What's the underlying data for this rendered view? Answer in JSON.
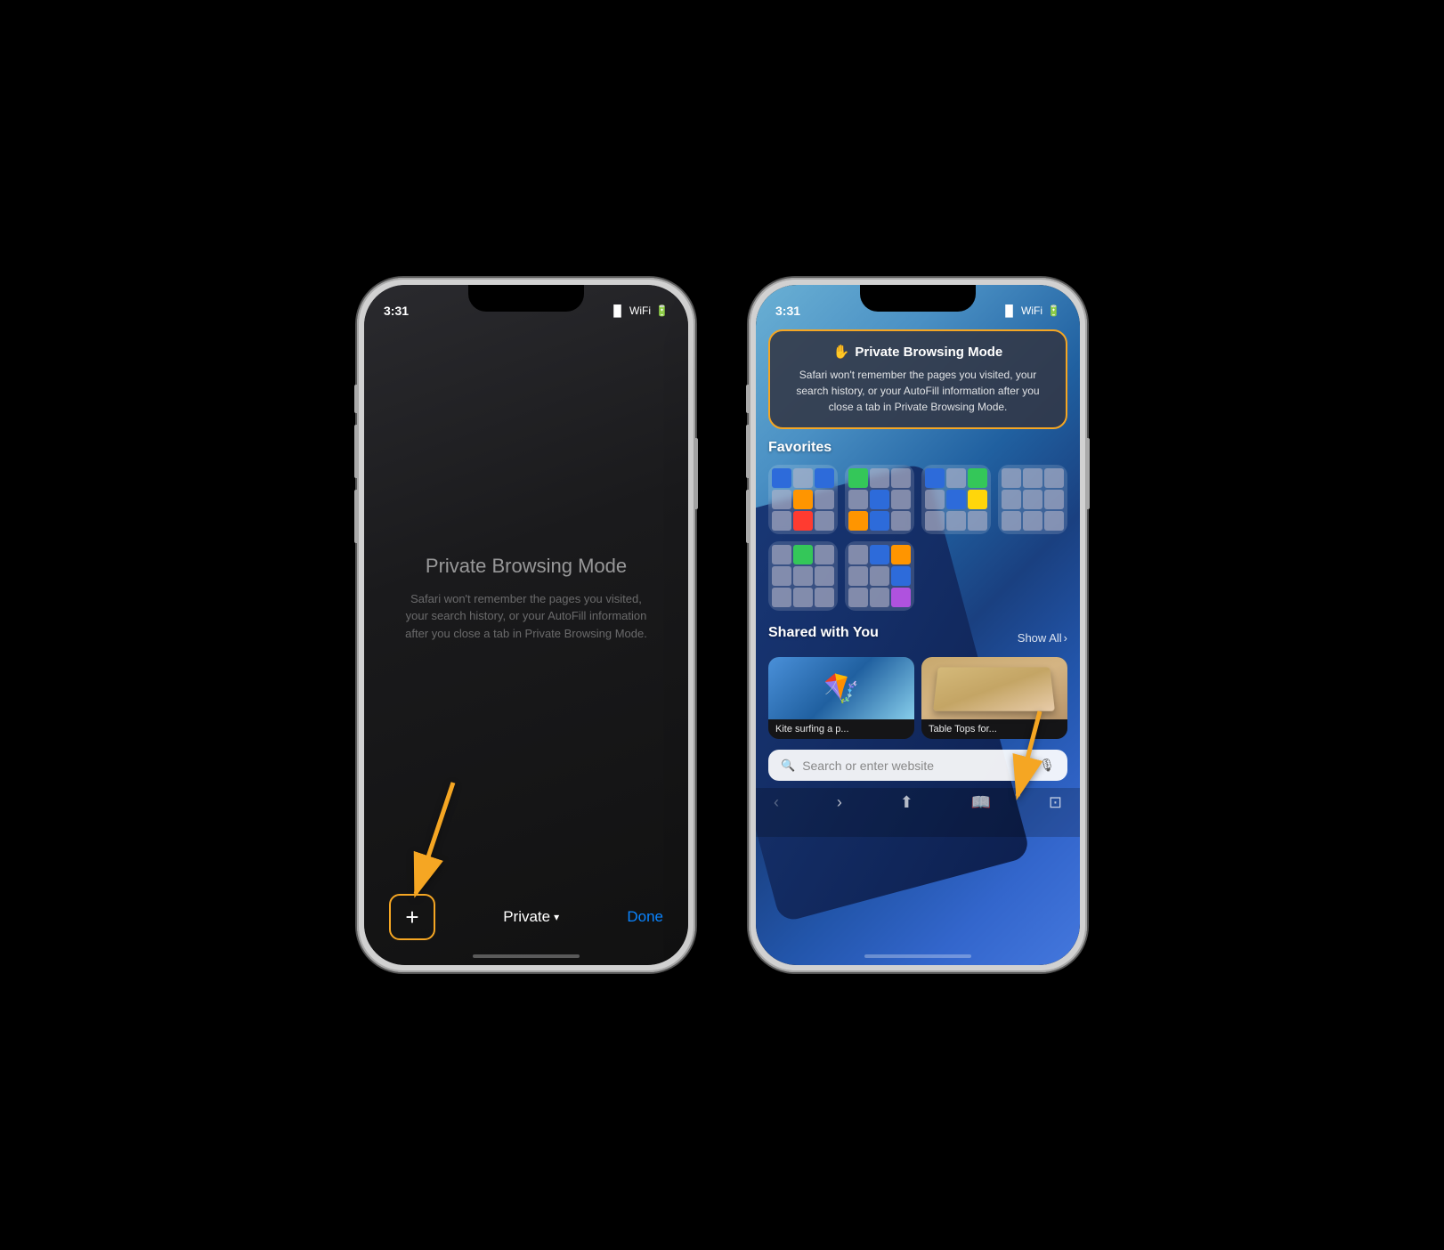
{
  "phone1": {
    "status_time": "3:31",
    "status_time_icon": "▶",
    "private_title": "Private Browsing Mode",
    "private_desc": "Safari won't remember the pages you visited, your search history, or your AutoFill information after you close a tab in Private Browsing Mode.",
    "plus_label": "+",
    "private_label": "Private",
    "caret": "▾",
    "done_label": "Done"
  },
  "phone2": {
    "status_time": "3:31",
    "pb_card_icon": "✋",
    "pb_card_title": "Private Browsing Mode",
    "pb_card_desc": "Safari won't remember the pages you visited, your search history, or your AutoFill information after you close a tab in Private Browsing Mode.",
    "favorites_title": "Favorites",
    "shared_title": "Shared with You",
    "show_all_label": "Show All",
    "card1_label": "Kite surfing a p...",
    "card2_label": "Table Tops for...",
    "search_placeholder": "Search or enter website"
  },
  "colors": {
    "orange": "#f5a623",
    "blue": "#0a84ff"
  }
}
